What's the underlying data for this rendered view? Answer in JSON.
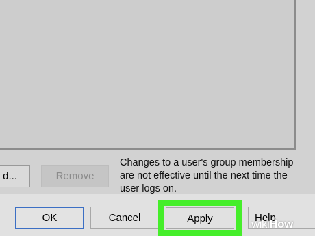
{
  "group_dialog": {
    "add_button_label": "d...",
    "remove_button_label": "Remove",
    "membership_note": "Changes to a user's group membership are not effective until the next time the user logs on."
  },
  "dialog_buttons": {
    "ok_label": "OK",
    "cancel_label": "Cancel",
    "apply_label": "Apply",
    "help_label": "Help"
  },
  "watermark": {
    "prefix": "wiki",
    "suffix": "How"
  },
  "colors": {
    "highlight": "#45ee2a",
    "default_button_border": "#3c6fc4",
    "disabled_text": "#8b8b8b"
  }
}
